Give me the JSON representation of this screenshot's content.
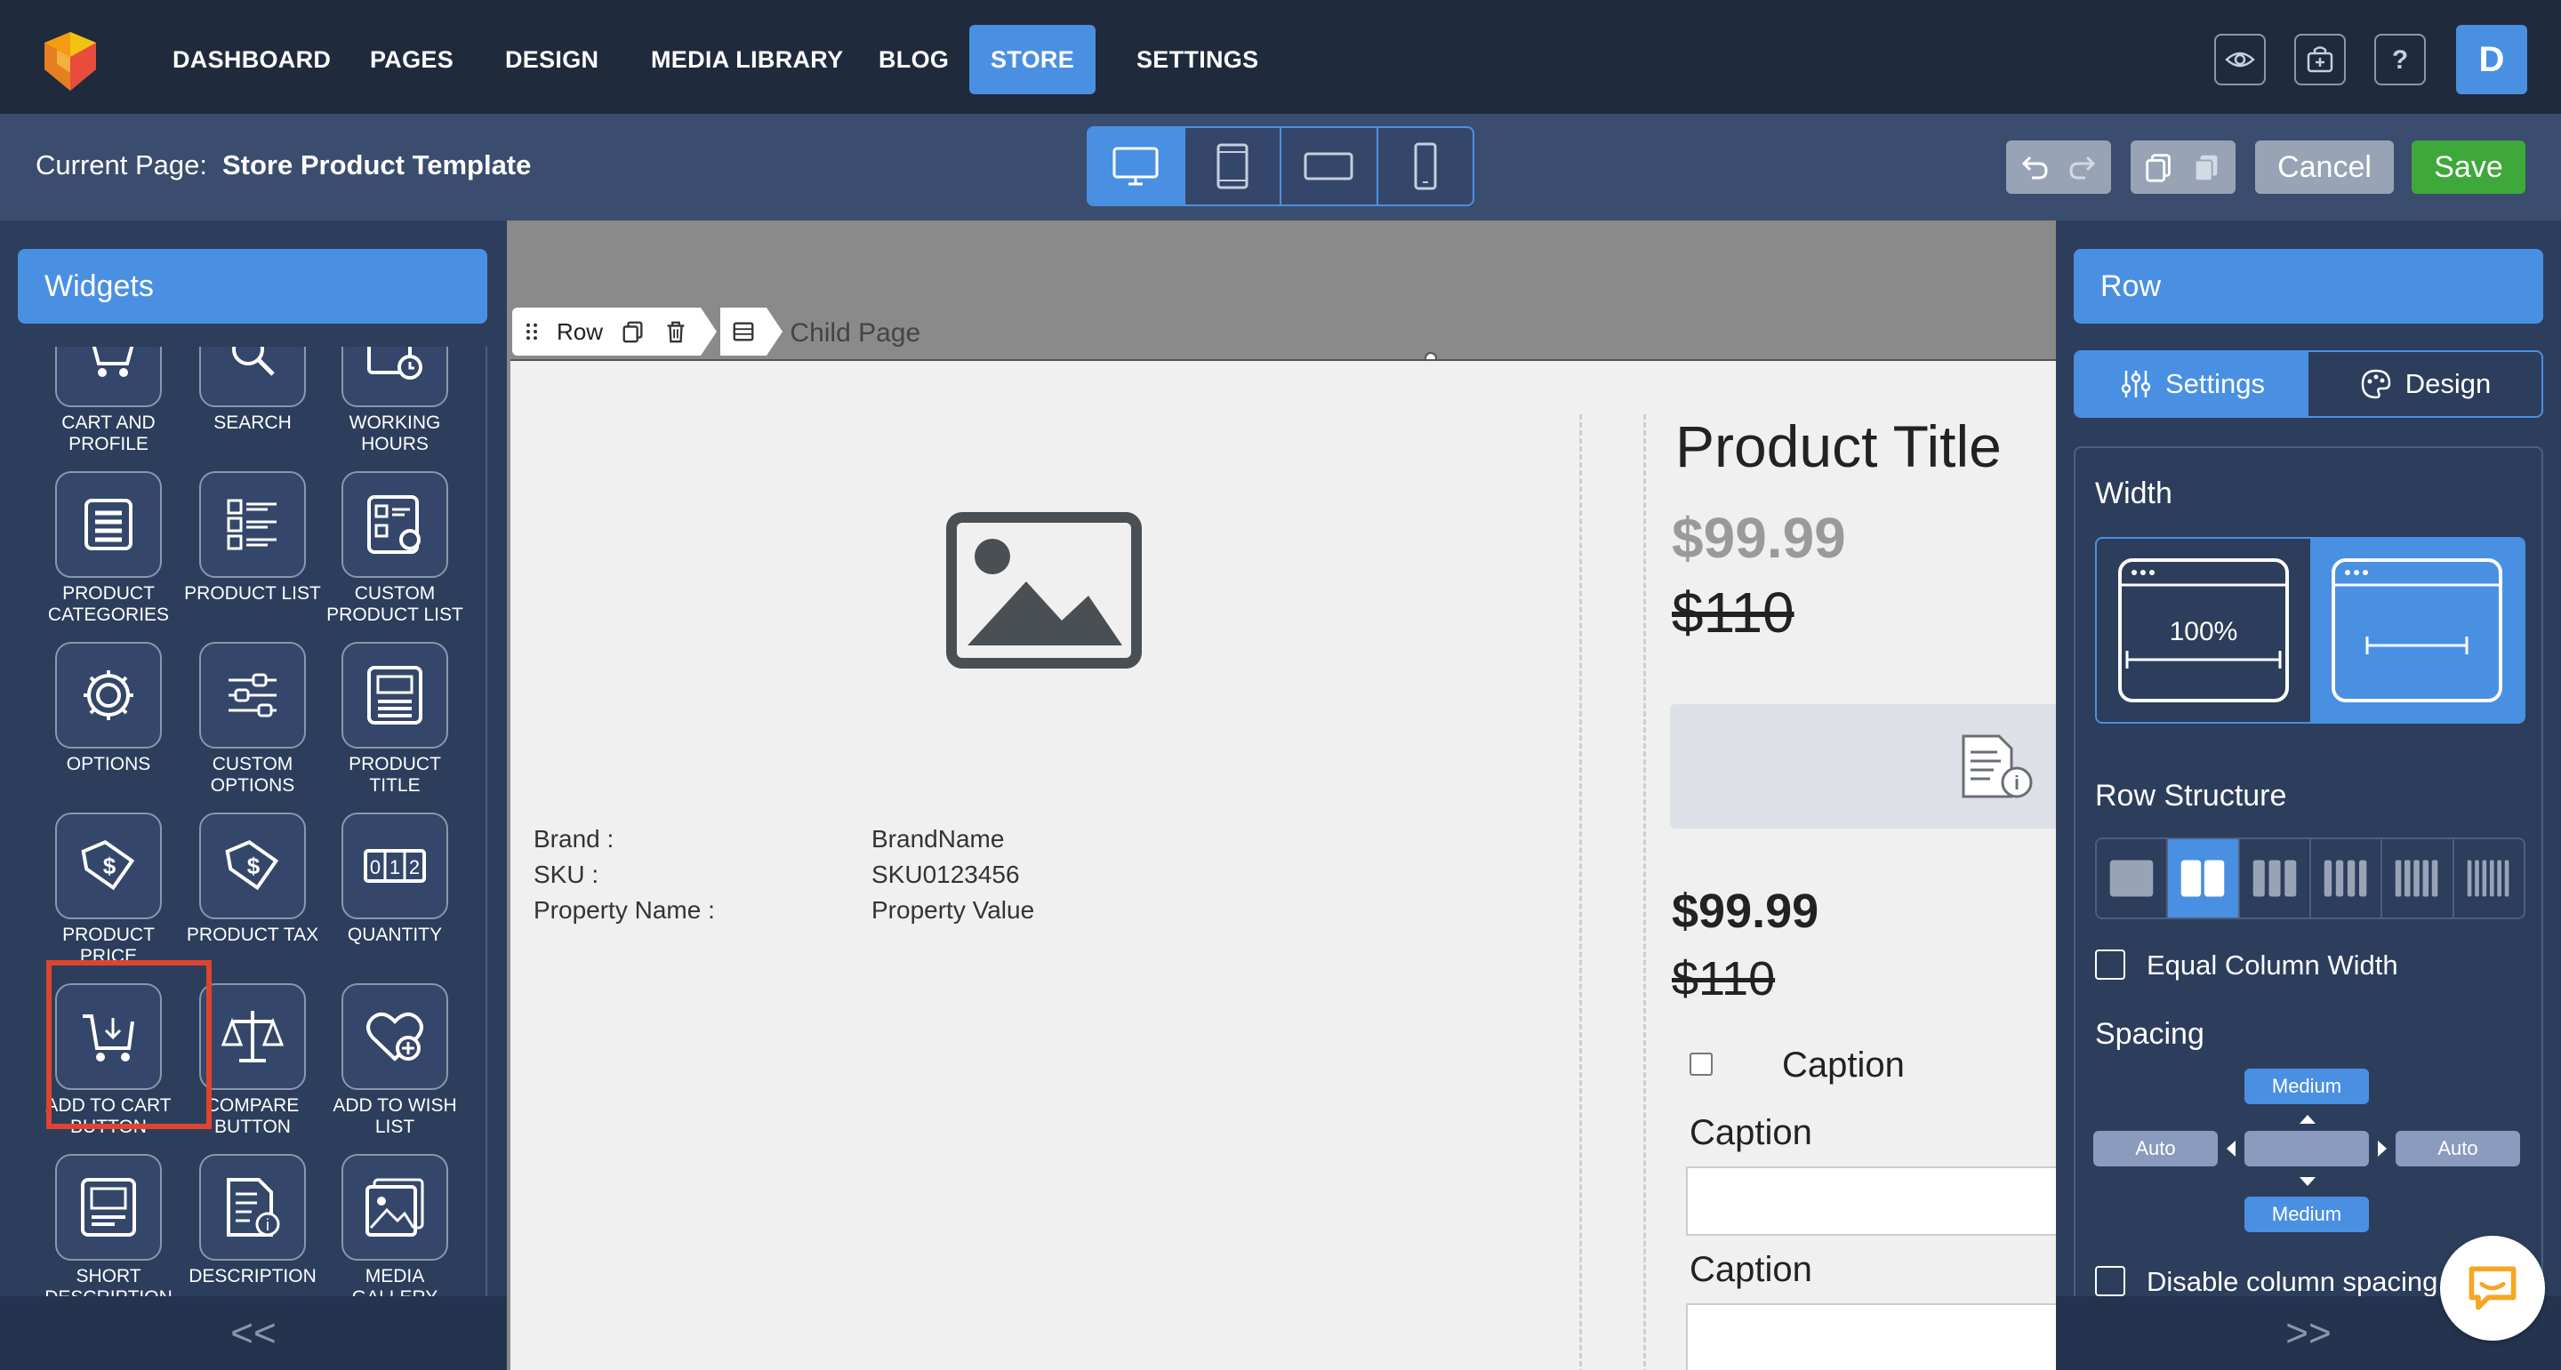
{
  "nav": {
    "items": [
      "DASHBOARD",
      "PAGES",
      "DESIGN",
      "MEDIA LIBRARY",
      "BLOG",
      "STORE",
      "SETTINGS"
    ],
    "active": "STORE",
    "avatar_letter": "D"
  },
  "subbar": {
    "current_page_label": "Current Page:",
    "current_page_value": "Store Product Template",
    "cancel_label": "Cancel",
    "save_label": "Save"
  },
  "widgets": {
    "title": "Widgets",
    "items": [
      {
        "label": "CART AND PROFILE",
        "icon": "cart-icon"
      },
      {
        "label": "SEARCH",
        "icon": "search-icon"
      },
      {
        "label": "WORKING HOURS",
        "icon": "clock-icon"
      },
      {
        "label": "PRODUCT CATEGORIES",
        "icon": "list-icon"
      },
      {
        "label": "PRODUCT LIST",
        "icon": "product-list-icon"
      },
      {
        "label": "CUSTOM PRODUCT LIST",
        "icon": "custom-list-icon"
      },
      {
        "label": "OPTIONS",
        "icon": "gear-icon"
      },
      {
        "label": "CUSTOM OPTIONS",
        "icon": "sliders-icon"
      },
      {
        "label": "PRODUCT TITLE",
        "icon": "title-icon"
      },
      {
        "label": "PRODUCT PRICE",
        "icon": "price-tag-icon"
      },
      {
        "label": "PRODUCT TAX",
        "icon": "tax-tag-icon"
      },
      {
        "label": "QUANTITY",
        "icon": "quantity-icon"
      },
      {
        "label": "ADD TO CART BUTTON",
        "icon": "add-cart-icon"
      },
      {
        "label": "COMPARE BUTTON",
        "icon": "scale-icon"
      },
      {
        "label": "ADD TO WISH LIST",
        "icon": "heart-plus-icon"
      },
      {
        "label": "SHORT DESCRIPTION",
        "icon": "short-desc-icon"
      },
      {
        "label": "DESCRIPTION",
        "icon": "desc-icon"
      },
      {
        "label": "MEDIA GALLERY",
        "icon": "gallery-icon"
      }
    ],
    "collapse_label": "<<"
  },
  "canvas": {
    "toolbar_label": "Row",
    "breadcrumb_tail": "ge",
    "breadcrumb_sep": "/",
    "breadcrumb_child": "Child Page",
    "properties": [
      {
        "label": "Brand :",
        "value": "BrandName"
      },
      {
        "label": "SKU :",
        "value": "SKU0123456"
      },
      {
        "label": "Property Name :",
        "value": "Property Value"
      }
    ],
    "product_title": "Product Title",
    "price": "$99.99",
    "old_price": "$110",
    "price2": "$99.99",
    "old_price2": "$110",
    "caption_check": "Caption",
    "caption_1": "Caption",
    "caption_2": "Caption"
  },
  "right": {
    "title": "Row",
    "tab_settings": "Settings",
    "tab_design": "Design",
    "width_label": "Width",
    "width_full_text": "100%",
    "row_structure_label": "Row Structure",
    "equal_width_label": "Equal Column Width",
    "spacing_label": "Spacing",
    "spacing_top": "Medium",
    "spacing_bottom": "Medium",
    "spacing_left": "Auto",
    "spacing_right": "Auto",
    "disable_spacing_label": "Disable column spacing",
    "expand_label": ">>"
  },
  "colors": {
    "accent": "#4a90e2",
    "save": "#3fa83b",
    "highlight": "#e0442f"
  }
}
